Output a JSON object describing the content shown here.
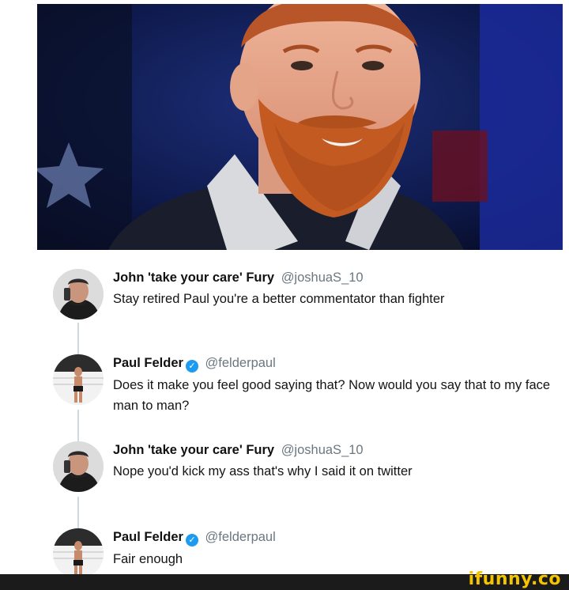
{
  "photo": {
    "icon": "photo-of-bearded-man"
  },
  "tweets": [
    {
      "name": "John 'take your care' Fury",
      "handle": "@joshuaS_10",
      "verified": false,
      "text": "Stay retired Paul you're a better commentator than fighter",
      "avatar": "avatar-man-on-phone"
    },
    {
      "name": "Paul Felder",
      "handle": "@felderpaul",
      "verified": true,
      "text": "Does it make you feel good saying that? Now would you say that to my face man to man?",
      "avatar": "avatar-fighter-in-cage"
    },
    {
      "name": "John 'take your care' Fury",
      "handle": "@joshuaS_10",
      "verified": false,
      "text": "Nope you'd kick my ass that's why I said it on twitter",
      "avatar": "avatar-man-on-phone"
    },
    {
      "name": "Paul Felder",
      "handle": "@felderpaul",
      "verified": true,
      "text": "Fair enough",
      "avatar": "avatar-fighter-in-cage"
    }
  ],
  "watermark": {
    "text": "ifunny.co",
    "color": "#f5c400"
  },
  "colors": {
    "handle": "#6b7780",
    "verified": "#1d9bf0",
    "thread": "#cfd9de"
  }
}
